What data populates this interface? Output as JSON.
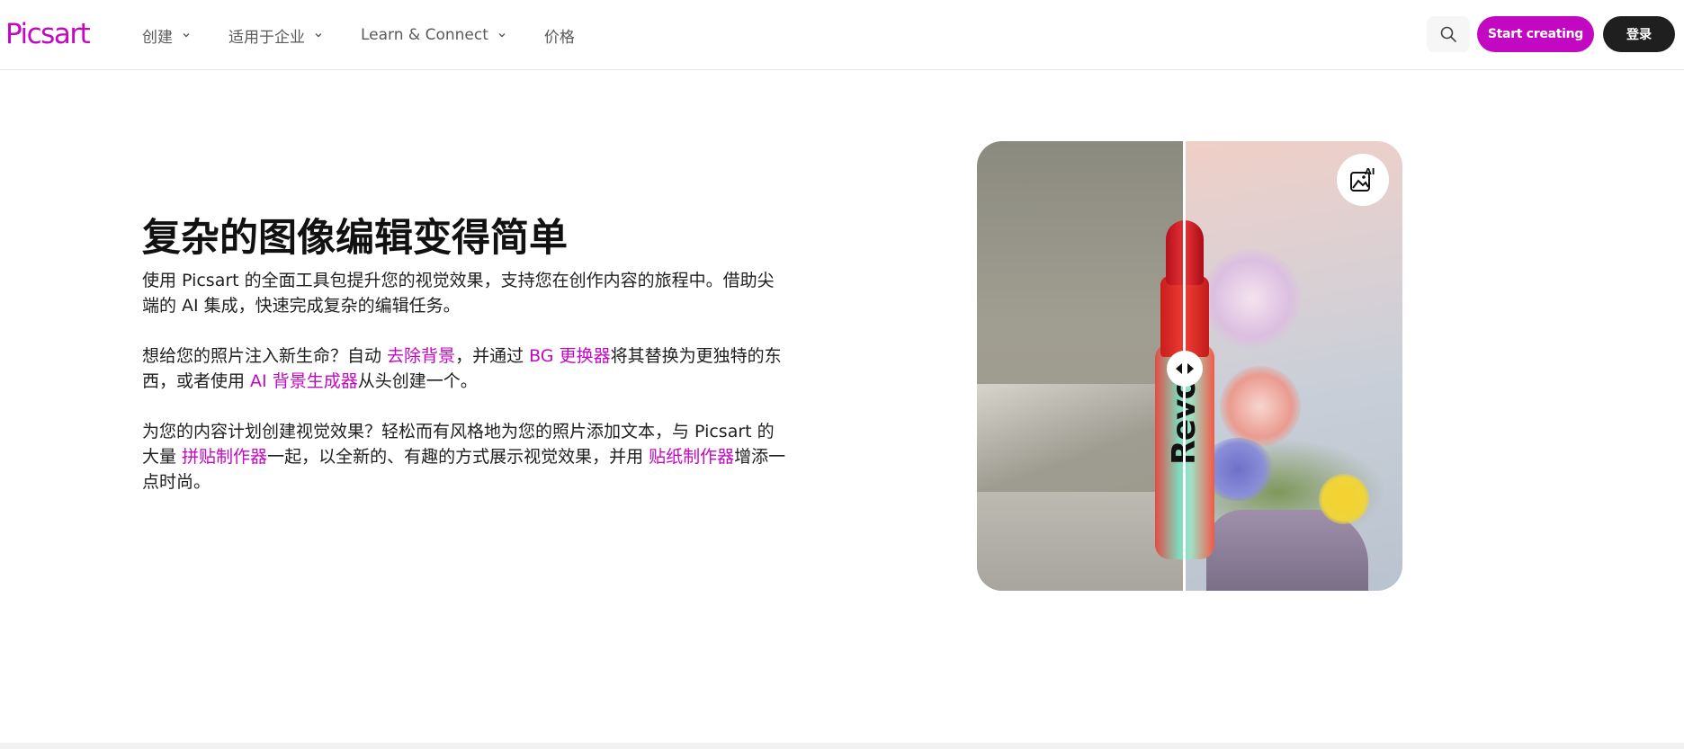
{
  "header": {
    "logo": "Picsart",
    "nav": [
      {
        "label": "创建",
        "has_dropdown": true
      },
      {
        "label": "适用于企业",
        "has_dropdown": true
      },
      {
        "label": "Learn & Connect",
        "has_dropdown": true
      },
      {
        "label": "价格",
        "has_dropdown": false
      }
    ],
    "search_icon": "search-icon",
    "start_button": "Start creating",
    "login_button": "登录"
  },
  "main": {
    "headline": "复杂的图像编辑变得简单",
    "p1": {
      "text": "使用 Picsart 的全面工具包提升您的视觉效果，支持您在创作内容的旅程中。借助尖端的 AI 集成，快速完成复杂的编辑任务。"
    },
    "p2": {
      "t1": "想给您的照片注入新生命？自动 ",
      "link1": "去除背景",
      "t2": "，并通过 ",
      "link2": "BG 更换器",
      "t3": "将其替换为更独特的东西，或者使用 ",
      "link3": "AI 背景生成器",
      "t4": "从头创建一个。"
    },
    "p3": {
      "t1": "为您的内容计划创建视觉效果？轻松而有风格地为您的照片添加文本，与 Picsart 的大量 ",
      "link1": "拼贴制作器",
      "t2": "一起，以全新的、有趣的方式展示视觉效果，并用 ",
      "link2": "贴纸制作器",
      "t3": "增添一点时尚。"
    }
  },
  "image_card": {
    "product_text": "Revo",
    "ai_badge_icon": "ai-image-icon",
    "slider_icon": "compare-arrows-icon"
  },
  "colors": {
    "brand": "#c209c1",
    "dark_button": "#1f1f1f"
  }
}
